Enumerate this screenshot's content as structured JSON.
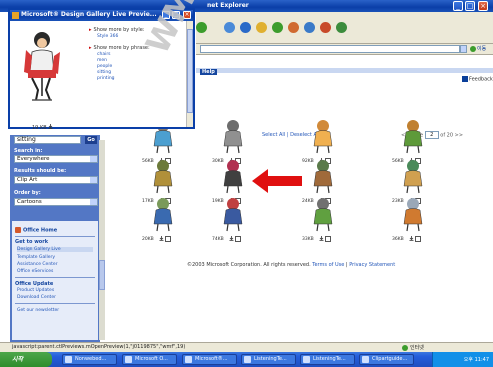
{
  "window": {
    "title": "net Explorer",
    "address_go": "이동",
    "feedback": "Feedback",
    "help_tab": "Help"
  },
  "sidebar": {
    "search_value": "sitting",
    "search_go": "Go",
    "search_in_label": "Search in:",
    "search_in_value": "Everywhere",
    "results_label": "Results should be:",
    "results_value": "Clip Art",
    "order_label": "Order by:",
    "order_value": "Cartoons",
    "office_home": "Office Home",
    "get_to_work_label": "Get to work",
    "get_to_work_links": [
      "Design Gallery Live",
      "Template Gallery",
      "Assistance Center",
      "Office eServices"
    ],
    "office_update_label": "Office Update",
    "office_update_links": [
      "Product Updates",
      "Download Center"
    ],
    "newsletter": "Get our newsletter"
  },
  "results": {
    "select_all": "Select All",
    "deselect_all": "Deselect All",
    "pager_prev": "<< Page",
    "page_value": "2",
    "pager_of": "of 20",
    "pager_next": ">>",
    "tiles": [
      {
        "size": "56KB",
        "color": "#8a7a6a",
        "accent": "#4c9fd0"
      },
      {
        "size": "30KB",
        "color": "#6d6d6d",
        "accent": "#909090"
      },
      {
        "size": "92KB",
        "color": "#d18a3a",
        "accent": "#f0b050"
      },
      {
        "size": "56KB",
        "color": "#c08030",
        "accent": "#5e9a3a"
      },
      {
        "size": "17KB",
        "color": "#6c7a3a",
        "accent": "#b0903a"
      },
      {
        "size": "19KB",
        "color": "#b03050",
        "accent": "#404040"
      },
      {
        "size": "24KB",
        "color": "#5a7a4a",
        "accent": "#a06a3a"
      },
      {
        "size": "23KB",
        "color": "#4a8a5a",
        "accent": "#d0a050"
      },
      {
        "size": "20KB",
        "color": "#7a9a5a",
        "accent": "#3a6ab0"
      },
      {
        "size": "74KB",
        "color": "#c04040",
        "accent": "#3a5aa0"
      },
      {
        "size": "33KB",
        "color": "#707070",
        "accent": "#60a040"
      },
      {
        "size": "36KB",
        "color": "#9aa8b8",
        "accent": "#d07a30"
      }
    ],
    "copyright": "©2003 Microsoft Corporation. All rights reserved.",
    "terms": "Terms of Use",
    "privacy": "Privacy Statement"
  },
  "popup": {
    "title": "Microsoft® Design Gallery Live Previe...",
    "size": "19 KB",
    "watermark": "WMF",
    "more_by_style_label": "Show more by style:",
    "style_link": "Style 366",
    "more_by_phrase_label": "Show more by phrase:",
    "phrase_links": [
      "chairs",
      "men",
      "people",
      "sitting",
      "printing"
    ]
  },
  "status": {
    "text": "javascript:parent.ctlPreviews.mOpenPreview(1,\"j0119875\",\"wmf\",19)",
    "zone": "인터넷"
  },
  "taskbar": {
    "start": "시작",
    "tasks": [
      "Nonwebed...",
      "Microsoft O...",
      "Microsoft®...",
      "ListeningTe...",
      "ListeningTe...",
      "Clipartguide..."
    ],
    "clock": "오후 11:47"
  }
}
